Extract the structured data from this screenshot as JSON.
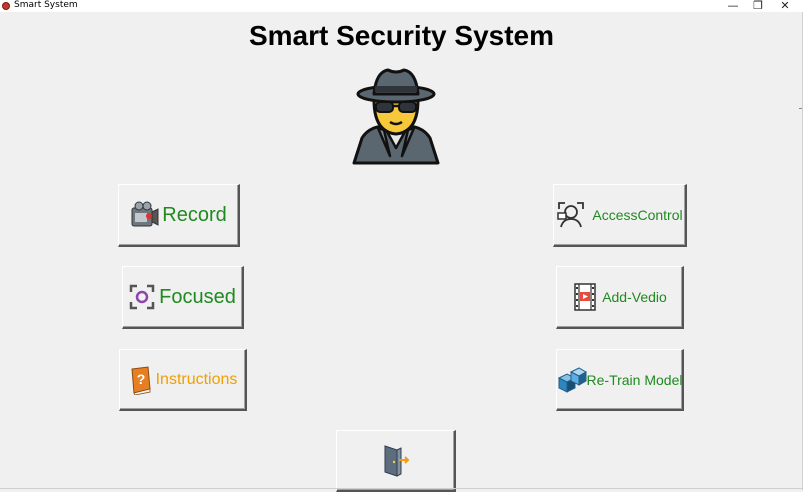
{
  "window": {
    "title": "Smart System",
    "controls": {
      "minimize": "—",
      "restore": "❐",
      "close": "✕"
    }
  },
  "app": {
    "heading": "Smart Security System",
    "hero_icon": "spy-agent-icon"
  },
  "buttons": {
    "record": {
      "label": "Record",
      "icon": "camcorder-icon",
      "color": "#1f8a1f"
    },
    "focused": {
      "label": "Focused",
      "icon": "focus-target-icon",
      "color": "#1f8a1f"
    },
    "instructions": {
      "label": "Instructions",
      "icon": "help-book-icon",
      "color": "#f0a000"
    },
    "access_control": {
      "label": "AccessControl",
      "icon": "face-scan-icon",
      "color": "#1f8a1f"
    },
    "add_video": {
      "label": "Add-Vedio",
      "icon": "film-strip-icon",
      "color": "#1f8a1f"
    },
    "retrain_model": {
      "label": "Re-Train Model",
      "icon": "stacked-cubes-icon",
      "color": "#1f8a1f"
    },
    "exit": {
      "label": "",
      "icon": "exit-door-icon"
    }
  }
}
